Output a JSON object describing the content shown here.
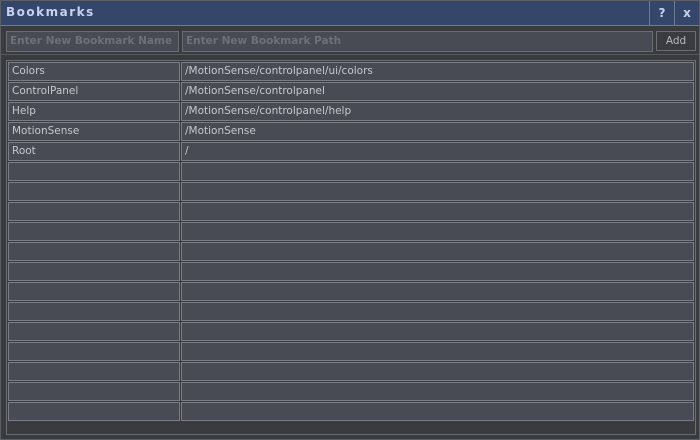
{
  "window": {
    "title": "Bookmarks",
    "help_label": "?",
    "close_label": "x"
  },
  "form": {
    "name_placeholder": "Enter New Bookmark Name",
    "path_placeholder": "Enter New Bookmark Path",
    "add_label": "Add"
  },
  "bookmarks": [
    {
      "name": "Colors",
      "path": "/MotionSense/controlpanel/ui/colors"
    },
    {
      "name": "ControlPanel",
      "path": "/MotionSense/controlpanel"
    },
    {
      "name": "Help",
      "path": "/MotionSense/controlpanel/help"
    },
    {
      "name": "MotionSense",
      "path": "/MotionSense"
    },
    {
      "name": "Root",
      "path": "/"
    },
    {
      "name": "",
      "path": ""
    },
    {
      "name": "",
      "path": ""
    },
    {
      "name": "",
      "path": ""
    },
    {
      "name": "",
      "path": ""
    },
    {
      "name": "",
      "path": ""
    },
    {
      "name": "",
      "path": ""
    },
    {
      "name": "",
      "path": ""
    },
    {
      "name": "",
      "path": ""
    },
    {
      "name": "",
      "path": ""
    },
    {
      "name": "",
      "path": ""
    },
    {
      "name": "",
      "path": ""
    },
    {
      "name": "",
      "path": ""
    },
    {
      "name": "",
      "path": ""
    }
  ]
}
